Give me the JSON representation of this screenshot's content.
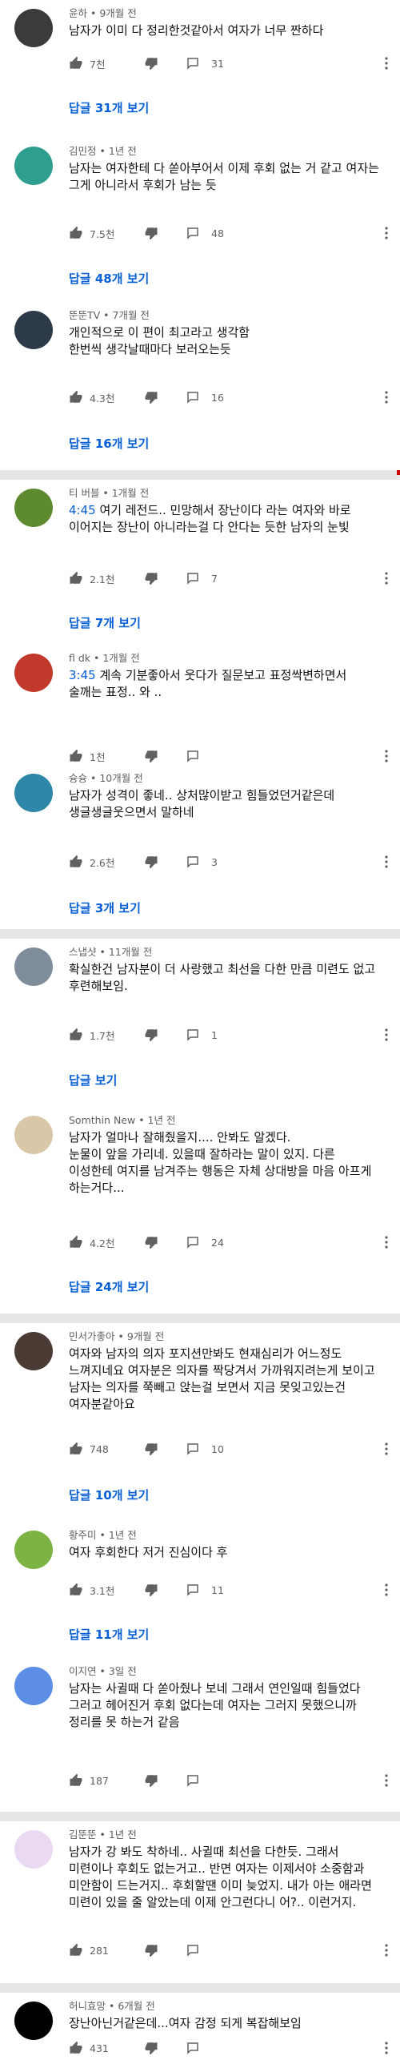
{
  "comments": [
    {
      "author": "윤하",
      "time": "9개월 전",
      "text": "남자가 이미 다 정리한것같아서 여자가 너무 짠하다",
      "likes": "7천",
      "replies_count": "31",
      "reply_label": "답글 31개 보기",
      "avatar_color": "#3b3b3b"
    },
    {
      "author": "김민정",
      "time": "1년 전",
      "text": "남자는 여자한테 다 쏟아부어서 이제 후회 없는 거 같고 여자는 그게 아니라서 후회가 남는 듯",
      "likes": "7.5천",
      "replies_count": "48",
      "reply_label": "답글 48개 보기",
      "avatar_color": "#2e9e8f"
    },
    {
      "author": "뚠뚠TV",
      "time": "7개월 전",
      "text": "개인적으로 이 편이 최고라고 생각함\n한번씩 생각날때마다 보러오는듯",
      "likes": "4.3천",
      "replies_count": "16",
      "reply_label": "답글 16개 보기",
      "avatar_color": "#2d3a4a"
    },
    {
      "author": "티 버블",
      "time": "1개월 전",
      "timestamp": "4:45",
      "text": " 여기 레전드.. 민망해서 장난이다 라는 여자와  바로 이어지는 장난이 아니라는걸 다 안다는 듯한 남자의 눈빛",
      "likes": "2.1천",
      "replies_count": "7",
      "reply_label": "답글 7개 보기",
      "avatar_color": "#5d8a2f"
    },
    {
      "author": "fl dk",
      "time": "1개월 전",
      "timestamp": "3:45",
      "text": " 계속 기분좋아서 웃다가 질문보고 표정싹변하면서 술깨는 표정.. 와 ..",
      "likes": "1천",
      "avatar_color": "#c0392b"
    },
    {
      "author": "슝슝",
      "time": "10개월 전",
      "text": "남자가 성격이 좋네.. 상처많이받고 힘들었던거같은데 생글생글웃으면서 말하네",
      "likes": "2.6천",
      "replies_count": "3",
      "reply_label": "답글 3개 보기",
      "avatar_color": "#2e86a8"
    },
    {
      "author": "스냅샷",
      "time": "11개월 전",
      "text": "확실한건 남자분이 더 사랑했고 최선을 다한 만큼 미련도 없고 후련해보임.",
      "likes": "1.7천",
      "replies_count": "1",
      "reply_label": "답글 보기",
      "avatar_color": "#7f8c9a"
    },
    {
      "author": "Somthin New",
      "time": "1년 전",
      "text": "남자가 얼마나 잘해줬을지.... 안봐도 알겠다.\n눈물이 앞을 가리네. 있을때 잘하라는 말이 있지. 다른 이성한테 여지를 남겨주는 행동은 자체 상대방을 마음 아프게 하는거다...",
      "likes": "4.2천",
      "replies_count": "24",
      "reply_label": "답글 24개 보기",
      "avatar_color": "#d8c8a8"
    },
    {
      "author": "민서가좋아",
      "time": "9개월 전",
      "text": "여자와 남자의 의자 포지션만봐도  현재심리가 어느정도 느껴지네요 여자분은 의자를 짝당겨서 가까워지려는게 보이고 남자는 의자를 쭉빼고 앉는걸 보면서 지금 못잊고있는건 여자분같아요",
      "likes": "748",
      "replies_count": "10",
      "reply_label": "답글 10개 보기",
      "avatar_color": "#4a3b35"
    },
    {
      "author": "황주미",
      "time": "1년 전",
      "text": "여자 후회한다 저거 진심이다 후",
      "likes": "3.1천",
      "replies_count": "11",
      "reply_label": "답글 11개 보기",
      "avatar_color": "#7cb342"
    },
    {
      "author": "이지연",
      "time": "3일 전",
      "text": "남자는 사귈때 다 쏟아줬나 보네 그래서 연인일때 힘들었다 그러고 헤어진거 후회 없다는데 여자는 그러지 못했으니까 정리를 못 하는거 같음",
      "likes": "187",
      "avatar_color": "#5c8ee6"
    },
    {
      "author": "김뚠뚠",
      "time": "1년 전",
      "text": "남자가 강 봐도 착하네.. 사귈때 최선을 다한듯. 그래서 미련이나 후회도 없는거고.. 반면 여자는 이제서야 소중함과 미안함이 드는거지.. 후회할땐 이미 늦었지. 내가 아는 애라면 미련이 있을 줄 알았는데 이제 안그런다니 어?.. 이런거지.",
      "likes": "281",
      "avatar_color": "#ead9f3"
    },
    {
      "author": "허니효망",
      "time": "6개월 전",
      "text": "장난아닌거같은데...여자 감정 되게 복잡해보임",
      "likes": "431",
      "avatar_color": "#000000"
    }
  ]
}
